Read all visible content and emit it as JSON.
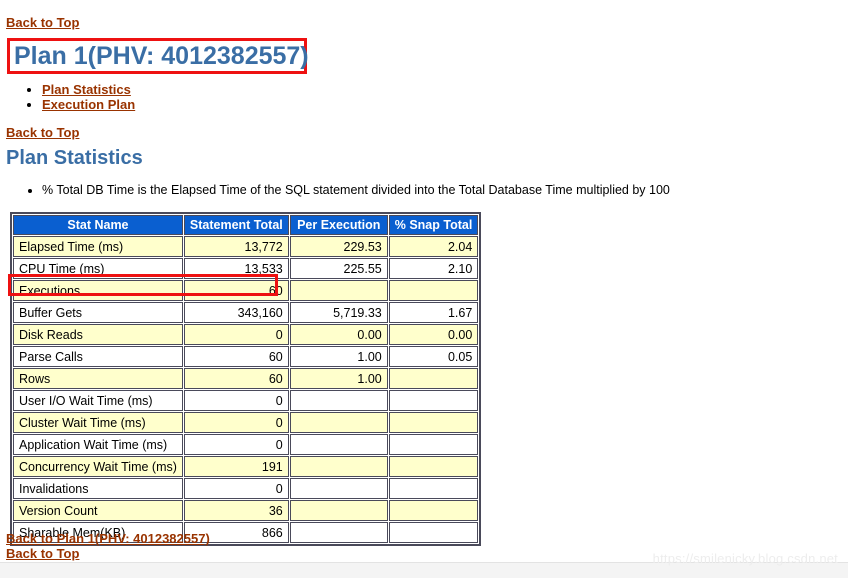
{
  "nav": {
    "back_to_top": "Back to Top",
    "back_to_plan": "Back to Plan 1(PHV: 4012382557)"
  },
  "header": {
    "plan_title": "Plan 1(PHV: 4012382557)",
    "section_title": "Plan Statistics"
  },
  "toc": {
    "items": [
      {
        "label": "Plan Statistics"
      },
      {
        "label": "Execution Plan"
      }
    ]
  },
  "notes": {
    "items": [
      "% Total DB Time is the Elapsed Time of the SQL statement divided into the Total Database Time multiplied by 100"
    ]
  },
  "colors": {
    "heading": "#3a6ea5",
    "link": "#993300",
    "table_header_bg": "#0a5fd0",
    "row_alt_bg": "#ffffcc",
    "highlight_box": "#ee1111"
  },
  "table": {
    "columns": [
      "Stat Name",
      "Statement Total",
      "Per Execution",
      "% Snap Total"
    ],
    "rows": [
      {
        "name": "Elapsed Time (ms)",
        "total": "13,772",
        "per": "229.53",
        "snap": "2.04"
      },
      {
        "name": "CPU Time (ms)",
        "total": "13,533",
        "per": "225.55",
        "snap": "2.10"
      },
      {
        "name": "Executions",
        "total": "60",
        "per": "",
        "snap": ""
      },
      {
        "name": "Buffer Gets",
        "total": "343,160",
        "per": "5,719.33",
        "snap": "1.67"
      },
      {
        "name": "Disk Reads",
        "total": "0",
        "per": "0.00",
        "snap": "0.00"
      },
      {
        "name": "Parse Calls",
        "total": "60",
        "per": "1.00",
        "snap": "0.05"
      },
      {
        "name": "Rows",
        "total": "60",
        "per": "1.00",
        "snap": ""
      },
      {
        "name": "User I/O Wait Time (ms)",
        "total": "0",
        "per": "",
        "snap": ""
      },
      {
        "name": "Cluster Wait Time (ms)",
        "total": "0",
        "per": "",
        "snap": ""
      },
      {
        "name": "Application Wait Time (ms)",
        "total": "0",
        "per": "",
        "snap": ""
      },
      {
        "name": "Concurrency Wait Time (ms)",
        "total": "191",
        "per": "",
        "snap": ""
      },
      {
        "name": "Invalidations",
        "total": "0",
        "per": "",
        "snap": ""
      },
      {
        "name": "Version Count",
        "total": "36",
        "per": "",
        "snap": ""
      },
      {
        "name": "Sharable Mem(KB)",
        "total": "866",
        "per": "",
        "snap": ""
      }
    ]
  },
  "watermark": {
    "text": "https://smilenicky.blog.csdn.net"
  }
}
